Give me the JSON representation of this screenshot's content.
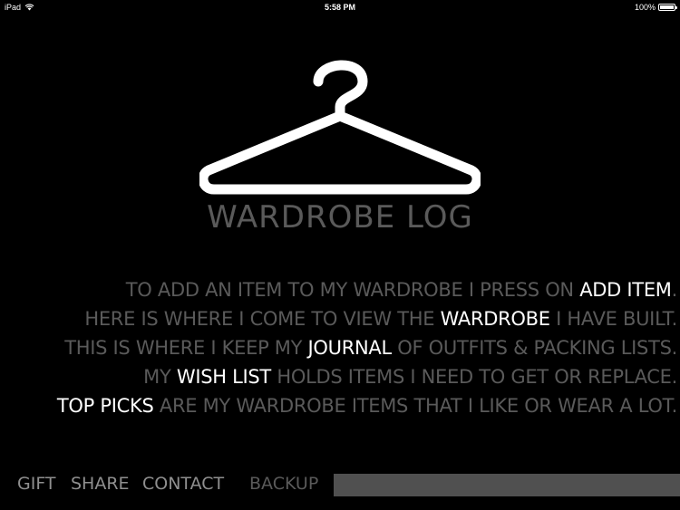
{
  "status_bar": {
    "device": "iPad",
    "time": "5:58 PM",
    "battery": "100%",
    "battery_level": 1.0
  },
  "app": {
    "title": "WARDROBE LOG"
  },
  "instructions": [
    {
      "before": "TO ADD AN ITEM TO MY WARDROBE I PRESS ON ",
      "link": "ADD ITEM",
      "after": "."
    },
    {
      "before": "HERE IS WHERE I COME TO VIEW THE ",
      "link": "WARDROBE",
      "after": " I HAVE BUILT."
    },
    {
      "before": "THIS IS WHERE I KEEP MY ",
      "link": "JOURNAL",
      "after": " OF OUTFITS & PACKING LISTS."
    },
    {
      "before": "MY ",
      "link": "WISH LIST",
      "after": " HOLDS ITEMS I NEED TO GET OR REPLACE."
    },
    {
      "before": "",
      "link": "TOP PICKS",
      "after": " ARE MY WARDROBE ITEMS THAT I LIKE OR WEAR A LOT."
    }
  ],
  "bottom_nav": {
    "gift": "GIFT",
    "share": "SHARE",
    "contact": "CONTACT",
    "backup": "BACKUP"
  },
  "colors": {
    "background": "#000000",
    "highlight": "#ffffff",
    "muted_text": "#5a5a5a",
    "nav_text": "#8f8f8f",
    "field": "#505050"
  },
  "icons": {
    "wifi": "wifi-icon",
    "battery": "battery-icon",
    "logo": "hanger-icon"
  }
}
